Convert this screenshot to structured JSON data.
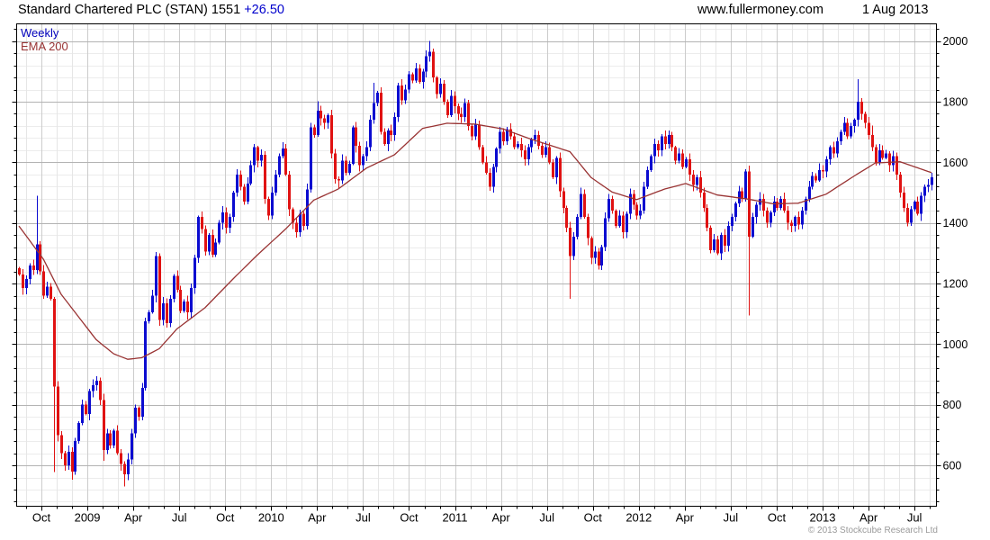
{
  "header": {
    "title": "Standard Chartered PLC (STAN) 1551",
    "change": "+26.50",
    "site": "www.fullermoney.com",
    "date": "1 Aug 2013"
  },
  "legend": {
    "series": "Weekly",
    "overlay": "EMA 200"
  },
  "footer": {
    "copyright": "© 2013 Stockcube Research Ltd"
  },
  "colors": {
    "up": "#0b0bd0",
    "down": "#e01212",
    "ema": "#993333",
    "grid_minor": "#ececec",
    "grid_major": "#b3b3b3",
    "grid_month": "#e6e6e6",
    "grid_quarter": "#cccccc",
    "axis": "#000000",
    "label": "#000000",
    "muted": "#9a9a9a"
  },
  "chart_data": {
    "type": "candlestick+line",
    "title": "Standard Chartered PLC (STAN) weekly candlestick chart with 200-period EMA",
    "last_price": 1551,
    "last_change": 26.5,
    "y_axis": {
      "min": 465,
      "max": 2057,
      "minor_step": 40,
      "major_step": 200,
      "tick_labels": [
        600,
        800,
        1000,
        1200,
        1400,
        1600,
        1800,
        2000
      ],
      "side": "right"
    },
    "x_axis": {
      "start_month": "Aug 2008",
      "end_month": "Aug 2013",
      "months_total": 60,
      "tick_labels": [
        {
          "m": 2,
          "label": "Oct"
        },
        {
          "m": 5,
          "label": "2009"
        },
        {
          "m": 8,
          "label": "Apr"
        },
        {
          "m": 11,
          "label": "Jul"
        },
        {
          "m": 14,
          "label": "Oct"
        },
        {
          "m": 17,
          "label": "2010"
        },
        {
          "m": 20,
          "label": "Apr"
        },
        {
          "m": 23,
          "label": "Jul"
        },
        {
          "m": 26,
          "label": "Oct"
        },
        {
          "m": 29,
          "label": "2011"
        },
        {
          "m": 32,
          "label": "Apr"
        },
        {
          "m": 35,
          "label": "Jul"
        },
        {
          "m": 38,
          "label": "Oct"
        },
        {
          "m": 41,
          "label": "2012"
        },
        {
          "m": 44,
          "label": "Apr"
        },
        {
          "m": 47,
          "label": "Jul"
        },
        {
          "m": 50,
          "label": "Oct"
        },
        {
          "m": 53,
          "label": "2013"
        },
        {
          "m": 56,
          "label": "Apr"
        },
        {
          "m": 59,
          "label": "Jul"
        }
      ]
    },
    "first_open": 1250,
    "weekly_closes": [
      1230,
      1185,
      1215,
      1260,
      1245,
      1330,
      1240,
      1160,
      1190,
      1150,
      860,
      700,
      640,
      600,
      645,
      580,
      680,
      740,
      800,
      770,
      845,
      865,
      880,
      815,
      650,
      705,
      665,
      715,
      640,
      605,
      570,
      620,
      705,
      790,
      760,
      855,
      1075,
      1105,
      1160,
      1290,
      1080,
      1135,
      1070,
      1150,
      1225,
      1180,
      1110,
      1140,
      1105,
      1185,
      1285,
      1420,
      1380,
      1305,
      1360,
      1295,
      1335,
      1400,
      1435,
      1385,
      1420,
      1500,
      1560,
      1520,
      1470,
      1530,
      1590,
      1650,
      1605,
      1625,
      1480,
      1425,
      1500,
      1560,
      1620,
      1645,
      1560,
      1445,
      1400,
      1370,
      1430,
      1390,
      1510,
      1715,
      1690,
      1770,
      1745,
      1730,
      1755,
      1630,
      1545,
      1540,
      1605,
      1565,
      1595,
      1715,
      1655,
      1590,
      1620,
      1650,
      1740,
      1795,
      1830,
      1700,
      1660,
      1705,
      1690,
      1750,
      1853,
      1805,
      1840,
      1890,
      1870,
      1910,
      1865,
      1900,
      1950,
      1965,
      1880,
      1825,
      1860,
      1800,
      1755,
      1820,
      1785,
      1760,
      1750,
      1795,
      1720,
      1685,
      1725,
      1650,
      1600,
      1565,
      1520,
      1585,
      1645,
      1700,
      1670,
      1710,
      1685,
      1650,
      1660,
      1640,
      1610,
      1650,
      1675,
      1690,
      1655,
      1625,
      1650,
      1600,
      1550,
      1615,
      1505,
      1450,
      1385,
      1290,
      1355,
      1420,
      1495,
      1420,
      1350,
      1285,
      1305,
      1260,
      1320,
      1415,
      1480,
      1440,
      1390,
      1425,
      1370,
      1430,
      1495,
      1460,
      1425,
      1440,
      1520,
      1575,
      1620,
      1660,
      1640,
      1685,
      1660,
      1690,
      1650,
      1605,
      1630,
      1585,
      1610,
      1560,
      1525,
      1550,
      1500,
      1450,
      1385,
      1310,
      1345,
      1300,
      1360,
      1325,
      1390,
      1420,
      1465,
      1505,
      1480,
      1570,
      1355,
      1420,
      1460,
      1480,
      1440,
      1400,
      1435,
      1470,
      1450,
      1480,
      1440,
      1400,
      1390,
      1420,
      1395,
      1440,
      1480,
      1520,
      1555,
      1540,
      1575,
      1570,
      1610,
      1650,
      1630,
      1670,
      1700,
      1730,
      1685,
      1720,
      1740,
      1800,
      1760,
      1730,
      1690,
      1650,
      1600,
      1640,
      1615,
      1630,
      1590,
      1620,
      1560,
      1500,
      1450,
      1400,
      1445,
      1470,
      1430,
      1490,
      1520,
      1525,
      1551
    ],
    "wick_overrides": {
      "5": {
        "high": 1490
      },
      "10": {
        "low": 578
      },
      "15": {
        "low": 552
      },
      "24": {
        "low": 615
      },
      "30": {
        "low": 530
      },
      "85": {
        "high": 1802
      },
      "91": {
        "low": 1512
      },
      "101": {
        "high": 1862
      },
      "117": {
        "high": 2000
      },
      "134": {
        "low": 1506
      },
      "157": {
        "low": 1150
      },
      "165": {
        "low": 1246
      },
      "208": {
        "low": 1095
      },
      "239": {
        "high": 1875
      },
      "243": {
        "high": 1722
      },
      "253": {
        "low": 1388
      }
    },
    "ema_200": {
      "points": [
        [
          0,
          1390
        ],
        [
          7,
          1280
        ],
        [
          12,
          1165
        ],
        [
          17,
          1090
        ],
        [
          22,
          1015
        ],
        [
          27,
          968
        ],
        [
          31,
          950
        ],
        [
          35,
          955
        ],
        [
          40,
          985
        ],
        [
          45,
          1050
        ],
        [
          53,
          1120
        ],
        [
          61,
          1215
        ],
        [
          68,
          1295
        ],
        [
          76,
          1380
        ],
        [
          84,
          1475
        ],
        [
          91,
          1512
        ],
        [
          99,
          1581
        ],
        [
          107,
          1625
        ],
        [
          115,
          1712
        ],
        [
          122,
          1729
        ],
        [
          130,
          1726
        ],
        [
          138,
          1710
        ],
        [
          145,
          1680
        ],
        [
          153,
          1650
        ],
        [
          157,
          1635
        ],
        [
          163,
          1550
        ],
        [
          169,
          1502
        ],
        [
          176,
          1477
        ],
        [
          184,
          1512
        ],
        [
          190,
          1530
        ],
        [
          199,
          1492
        ],
        [
          207,
          1480
        ],
        [
          215,
          1463
        ],
        [
          222,
          1465
        ],
        [
          230,
          1495
        ],
        [
          238,
          1555
        ],
        [
          244,
          1598
        ],
        [
          251,
          1602
        ],
        [
          256,
          1582
        ],
        [
          260,
          1566
        ]
      ]
    }
  }
}
